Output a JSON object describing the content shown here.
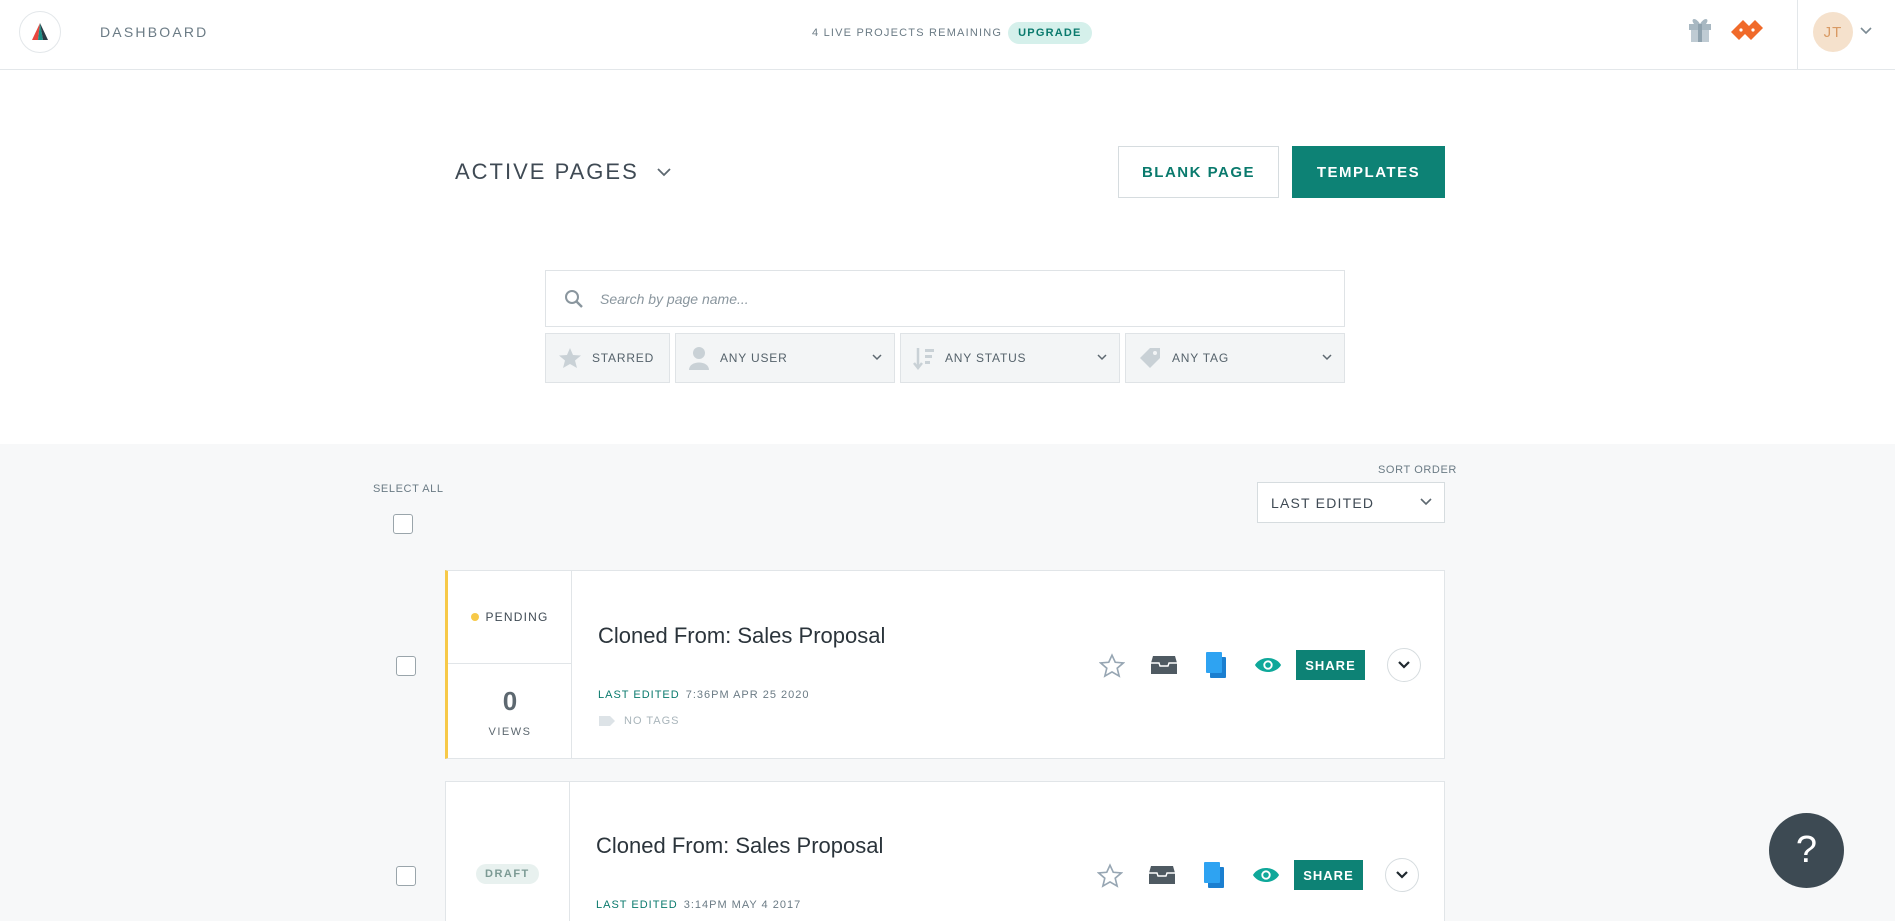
{
  "nav": {
    "title": "DASHBOARD",
    "live_projects": "4 LIVE PROJECTS REMAINING",
    "upgrade": "UPGRADE",
    "avatar_initials": "JT",
    "icons": [
      "logo-icon",
      "gift-icon",
      "tickets-icon",
      "chevron-down-icon"
    ]
  },
  "header": {
    "title": "ACTIVE PAGES",
    "blank_page": "BLANK PAGE",
    "templates": "TEMPLATES"
  },
  "search": {
    "placeholder": "Search by page name...",
    "value": ""
  },
  "filters": {
    "starred": "STARRED",
    "user": "ANY USER",
    "status": "ANY STATUS",
    "tag": "ANY TAG"
  },
  "list": {
    "select_all": "SELECT ALL",
    "sort_label": "SORT ORDER",
    "sort_value": "LAST EDITED",
    "pages": [
      {
        "status": "PENDING",
        "views": "0",
        "views_label": "VIEWS",
        "title": "Cloned From: Sales Proposal",
        "last_edited_label": "LAST EDITED",
        "last_edited": "7:36PM APR 25 2020",
        "tags": "NO TAGS",
        "share": "SHARE"
      },
      {
        "status": "DRAFT",
        "title": "Cloned From: Sales Proposal",
        "last_edited_label": "LAST EDITED",
        "last_edited": "3:14PM MAY 4 2017",
        "share": "SHARE"
      }
    ]
  },
  "help": "?",
  "colors": {
    "accent": "#0d8275",
    "pending": "#f7c948",
    "duplicate_blue": "#2ea3f2",
    "preview_teal": "#0fa89a"
  }
}
